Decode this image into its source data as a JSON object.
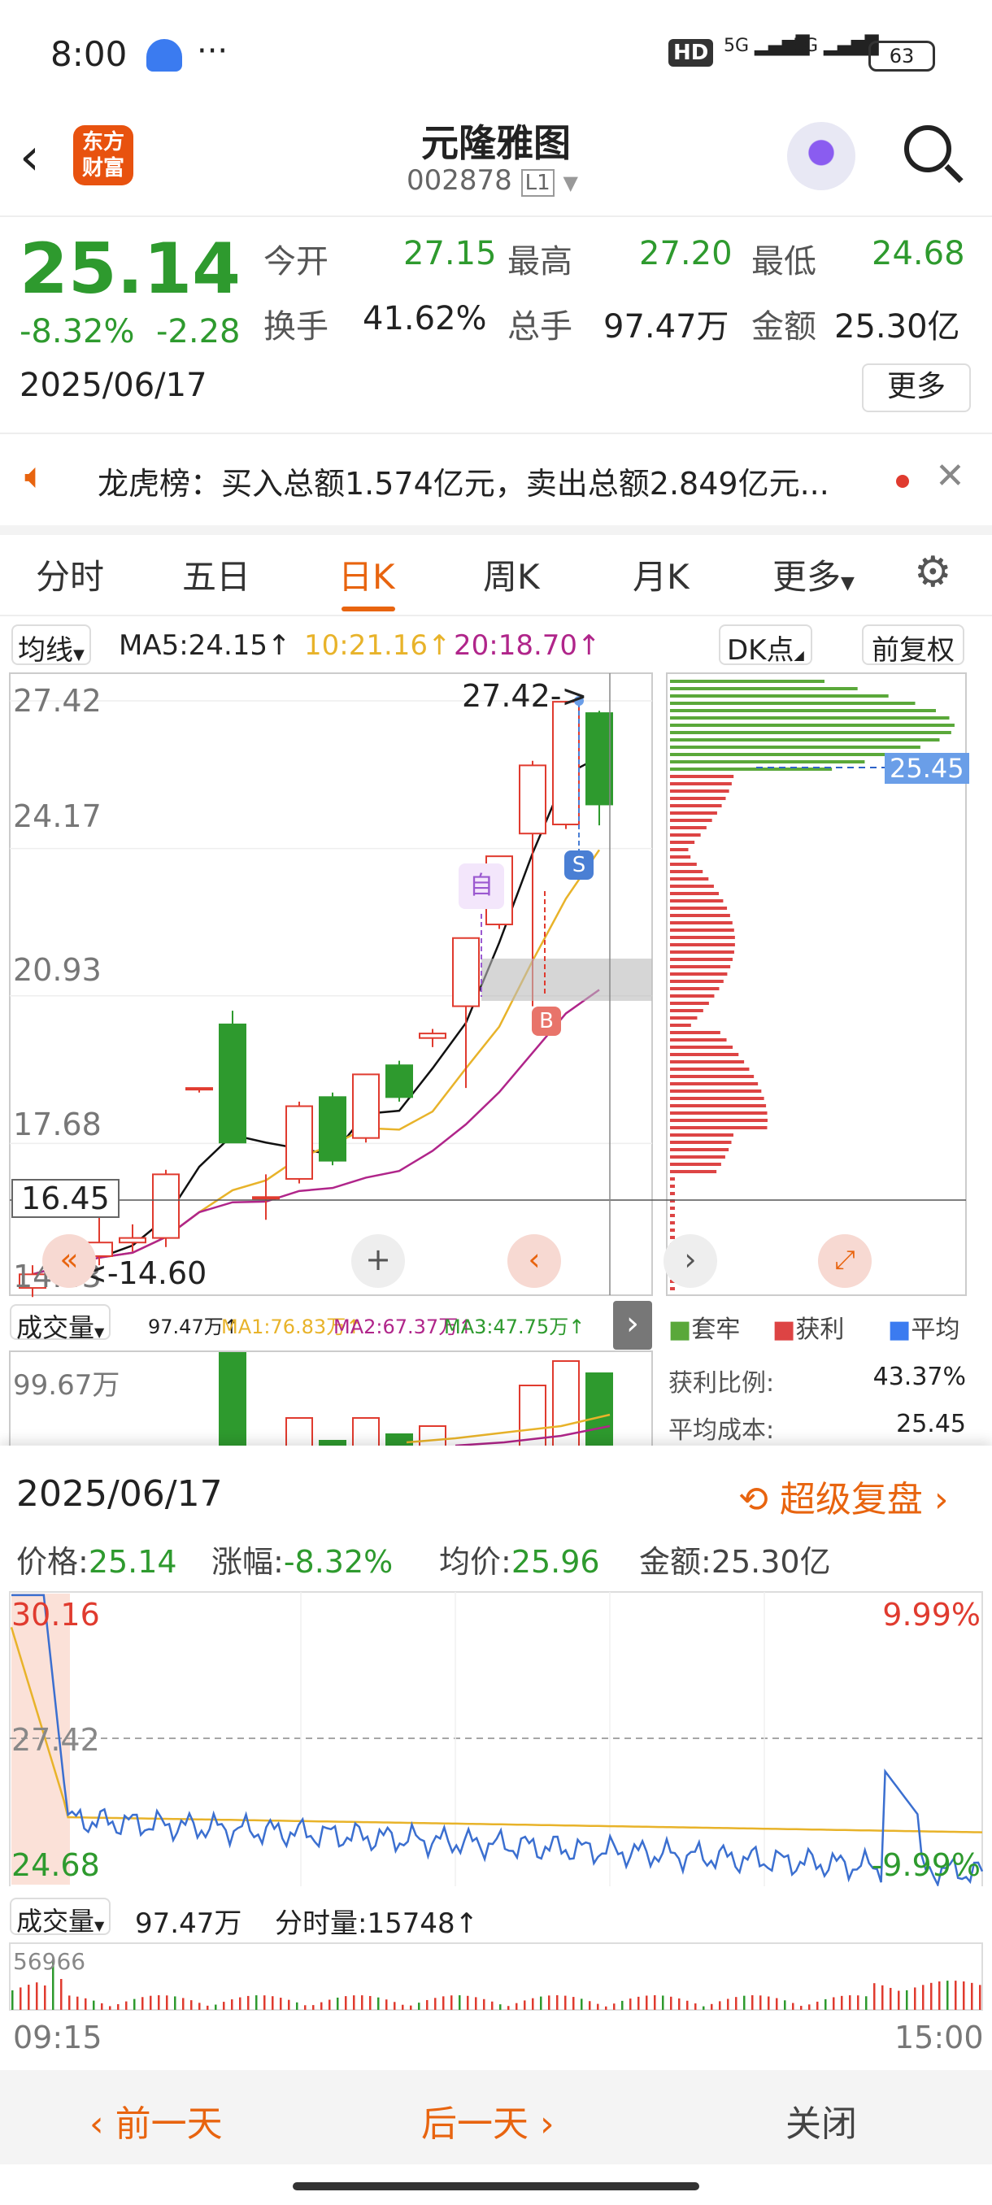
{
  "status": {
    "time": "8:00",
    "more": "···",
    "hd": "HD",
    "battery": "63",
    "signal_a": "5G",
    "signal_b": "5G"
  },
  "header": {
    "logo_line1": "东方",
    "logo_line2": "财富",
    "title": "元隆雅图",
    "code": "002878",
    "level": "L1"
  },
  "quote": {
    "price": "25.14",
    "pct": "-8.32%",
    "chg": "-2.28",
    "date": "2025/06/17",
    "rows": [
      [
        {
          "l": "今开",
          "v": "27.15"
        },
        {
          "l": "最高",
          "v": "27.20"
        },
        {
          "l": "最低",
          "v": "24.68"
        }
      ],
      [
        {
          "l": "换手",
          "v": "41.62%"
        },
        {
          "l": "总手",
          "v": "97.47万"
        },
        {
          "l": "金额",
          "v": "25.30亿"
        }
      ]
    ],
    "more_btn": "更多"
  },
  "notice": {
    "text": "龙虎榜：买入总额1.574亿元，卖出总额2.849亿元..."
  },
  "tabs": [
    "分时",
    "五日",
    "日K",
    "周K",
    "月K",
    "更多"
  ],
  "ma_bar": {
    "selector": "均线",
    "ma5": "MA5:24.15",
    "ma10": "10:21.16",
    "ma20": "20:18.70",
    "dk": "DK点",
    "fq": "前复权"
  },
  "kchart": {
    "axis": [
      "27.42",
      "24.17",
      "20.93",
      "17.68",
      "14.43"
    ],
    "high_label": "27.42->",
    "low_label": "<-14.60",
    "cross": "16.45",
    "zi": "自",
    "s": "S",
    "b": "B",
    "avg_tag": "25.45"
  },
  "chart_data": {
    "type": "candlestick",
    "days": [
      {
        "o": 14.5,
        "c": 14.8,
        "h": 15.0,
        "l": 14.3
      },
      {
        "o": 14.8,
        "c": 15.2,
        "h": 15.6,
        "l": 14.7
      },
      {
        "o": 15.2,
        "c": 15.5,
        "h": 16.1,
        "l": 15.0
      },
      {
        "o": 15.5,
        "c": 15.6,
        "h": 15.9,
        "l": 15.3
      },
      {
        "o": 15.6,
        "c": 17.0,
        "h": 17.1,
        "l": 15.4
      },
      {
        "o": 18.9,
        "c": 18.9,
        "h": 18.9,
        "l": 18.8
      },
      {
        "o": 20.3,
        "c": 17.7,
        "h": 20.6,
        "l": 17.7
      },
      {
        "o": 16.5,
        "c": 16.5,
        "h": 17.0,
        "l": 16.0
      },
      {
        "o": 16.9,
        "c": 18.5,
        "h": 18.6,
        "l": 16.8
      },
      {
        "o": 18.7,
        "c": 17.3,
        "h": 18.8,
        "l": 17.2
      },
      {
        "o": 17.8,
        "c": 19.2,
        "h": 19.2,
        "l": 17.7
      },
      {
        "o": 19.4,
        "c": 18.7,
        "h": 19.5,
        "l": 18.6
      },
      {
        "o": 20.0,
        "c": 20.1,
        "h": 20.2,
        "l": 19.8
      },
      {
        "o": 20.7,
        "c": 22.2,
        "h": 22.2,
        "l": 18.9
      },
      {
        "o": 22.5,
        "c": 24.0,
        "h": 24.0,
        "l": 22.4
      },
      {
        "o": 24.5,
        "c": 26.0,
        "h": 26.1,
        "l": 20.7
      },
      {
        "o": 24.7,
        "c": 27.4,
        "h": 27.42,
        "l": 24.6
      },
      {
        "o": 27.15,
        "c": 25.14,
        "h": 27.2,
        "l": 24.68
      }
    ]
  },
  "legend": {
    "a": "套牢",
    "b": "获利",
    "c": "平均"
  },
  "vol_bar": {
    "sel": "成交量",
    "v": "97.47万",
    "ma1": "MA1:76.83万",
    "ma2": "MA2:67.37万",
    "ma3": "MA3:47.75万",
    "axis": "99.67万"
  },
  "side": {
    "profit_label": "获利比例:",
    "profit": "43.37%",
    "cost_label": "平均成本:",
    "cost": "25.45"
  },
  "detail": {
    "date": "2025/06/17",
    "replay": "超级复盘",
    "price_l": "价格:",
    "price": "25.14",
    "pct_l": "涨幅:",
    "pct": "-8.32%",
    "avg_l": "均价:",
    "avg": "25.96",
    "amt_l": "金额:",
    "amt": "25.30亿"
  },
  "intraday": {
    "top": "30.16",
    "mid": "27.42",
    "bot": "24.68",
    "pct_top": "9.99%",
    "pct_bot": "-9.99%",
    "vol_sel": "成交量",
    "vol": "97.47万",
    "fs": "分时量:15748",
    "vol_axis": "56966",
    "t_start": "09:15",
    "t_end": "15:00"
  },
  "footer": {
    "prev": "前一天",
    "next": "后一天",
    "close": "关闭"
  },
  "colors": {
    "red": "#e03b2f",
    "green": "#2e9a2e",
    "orange": "#e8640f",
    "blue": "#4a7fd4"
  }
}
